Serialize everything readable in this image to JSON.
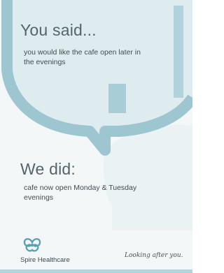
{
  "said": {
    "heading": "You said...",
    "text": "you would like the cafe open later in the evenings"
  },
  "did": {
    "heading": "We did:",
    "text": "cafe now open Monday & Tuesday evenings"
  },
  "brand": {
    "name": "Spire Healthcare",
    "tagline": "Looking after you."
  },
  "colors": {
    "teal_accent": "#9dc6d0",
    "bubble": "#dfecef",
    "background": "#f3f7f8"
  }
}
